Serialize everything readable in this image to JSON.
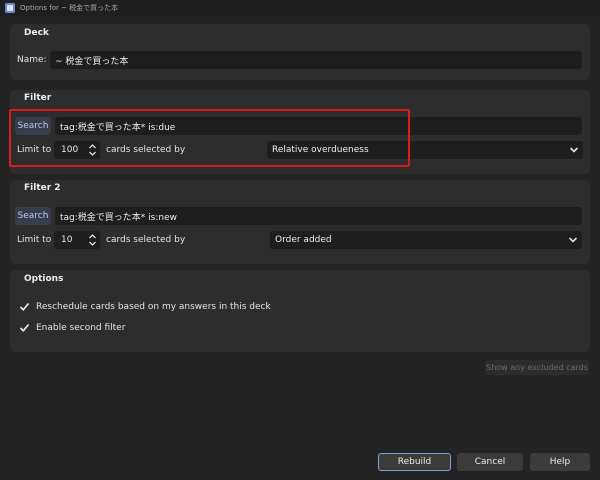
{
  "window": {
    "title": "Options for ~ 税金で買った本"
  },
  "deck": {
    "title": "Deck",
    "name_label": "Name:",
    "name_value": "~ 税金で買った本"
  },
  "filter1": {
    "title": "Filter",
    "search_label": "Search",
    "search_value": "tag:税金で買った本* is:due",
    "limit_label": "Limit to",
    "limit_value": "100",
    "selected_by_label": "cards selected by",
    "order_value": "Relative overdueness"
  },
  "filter2": {
    "title": "Filter 2",
    "search_label": "Search",
    "search_value": "tag:税金で買った本* is:new",
    "limit_label": "Limit to",
    "limit_value": "10",
    "selected_by_label": "cards selected by",
    "order_value": "Order added"
  },
  "options": {
    "title": "Options",
    "reschedule_label": "Reschedule cards based on my answers in this deck",
    "reschedule_checked": true,
    "second_filter_label": "Enable second filter",
    "second_filter_checked": true
  },
  "excluded_button": "Show any excluded cards",
  "buttons": {
    "rebuild": "Rebuild",
    "cancel": "Cancel",
    "help": "Help"
  },
  "colors": {
    "highlight": "#d91c1c",
    "accent": "#7e9fd8",
    "background": "#242424",
    "group": "#2d2d2d"
  }
}
